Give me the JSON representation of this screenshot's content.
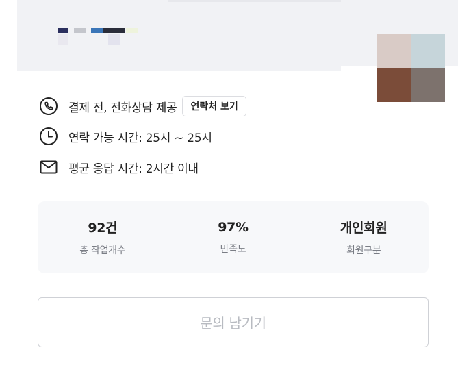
{
  "colors": {
    "banner_bg": "#f1f2f5",
    "swatches": [
      "#2b2f5e",
      "#c4c6cc",
      "#3b76b8",
      "#2a2d3a",
      "#eef3dc",
      "#e9e8ef",
      "#e3e3ee"
    ],
    "tiles": [
      "#d9cbc6",
      "#c6d5da",
      "#7b4c39",
      "#7d726d"
    ]
  },
  "contact": {
    "call_text": "결제 전, 전화상담 제공",
    "view_contact_button": "연락처 보기",
    "hours_text": "연락 가능 시간: 25시 ~ 25시",
    "response_text": "평균 응답 시간: 2시간 이내",
    "icons": [
      "phone-icon",
      "clock-icon",
      "mail-icon"
    ]
  },
  "stats": [
    {
      "value": "92건",
      "label": "총 작업개수"
    },
    {
      "value": "97%",
      "label": "만족도"
    },
    {
      "value": "개인회원",
      "label": "회원구분"
    }
  ],
  "inquiry_button": "문의 남기기"
}
